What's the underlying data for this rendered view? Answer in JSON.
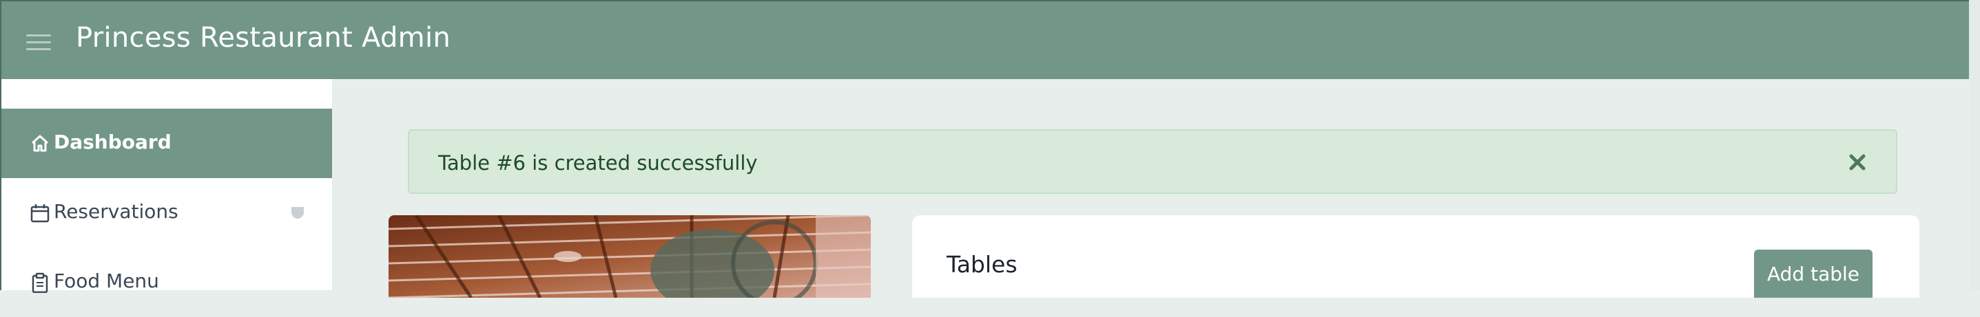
{
  "header": {
    "title": "Princess Restaurant Admin",
    "menu_icon": "hamburger-icon",
    "background": "#729788"
  },
  "sidebar": {
    "items": [
      {
        "label": "Dashboard",
        "icon": "home-icon",
        "active": true
      },
      {
        "label": "Reservations",
        "icon": "calendar-icon",
        "active": false,
        "badge_icon": "shield-badge-icon"
      },
      {
        "label": "Food Menu",
        "icon": "clipboard-icon",
        "active": false
      }
    ]
  },
  "alert": {
    "message": "Table #6 is created successfully",
    "close_icon": "close-icon",
    "background": "#d8ead9"
  },
  "tables_card": {
    "title": "Tables",
    "add_button_label": "Add table"
  },
  "colors": {
    "accent": "#729788",
    "page_background": "#e7eeeb",
    "alert_text": "#1e4a2a"
  }
}
